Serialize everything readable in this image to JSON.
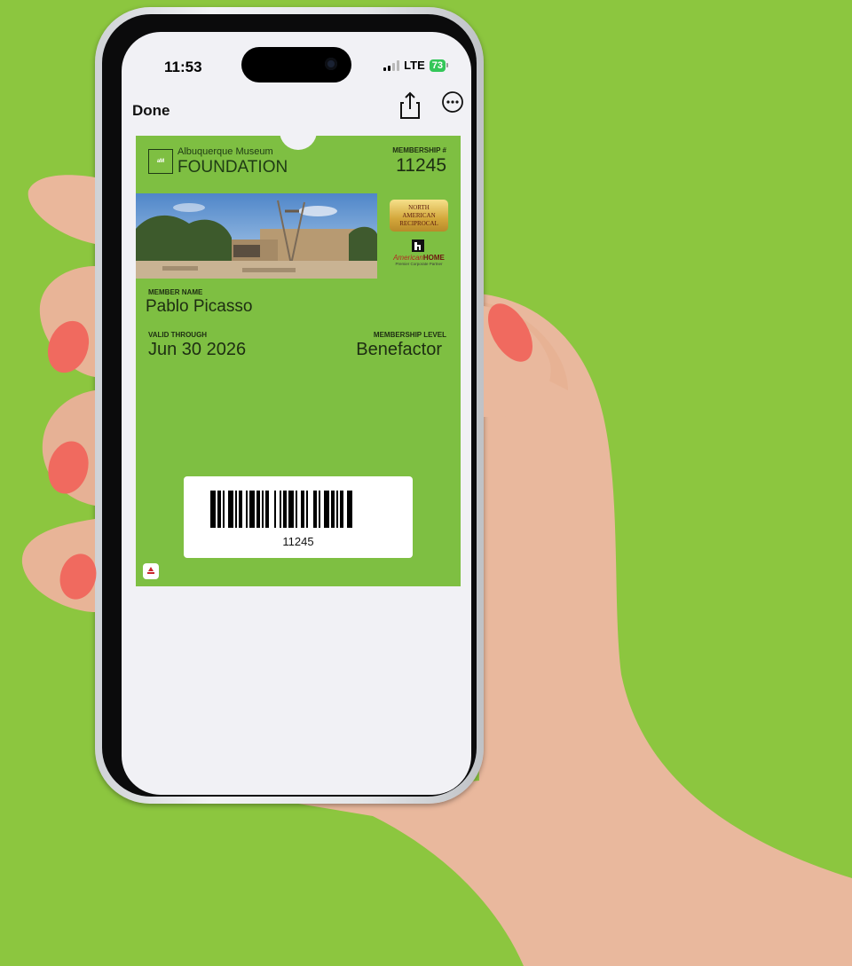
{
  "status_bar": {
    "time": "11:53",
    "network": "LTE",
    "battery_percent": "73"
  },
  "nav": {
    "done_label": "Done",
    "share_icon": "share-icon",
    "more_icon": "ellipsis-circle-icon"
  },
  "pass": {
    "logo": {
      "badge_text": "aM",
      "line1": "Albuquerque Museum",
      "line2": "FOUNDATION"
    },
    "membership_number_label": "MEMBERSHIP #",
    "membership_number": "11245",
    "reciprocal_badge": [
      "NORTH",
      "AMERICAN",
      "RECIPROCAL"
    ],
    "partner": {
      "name_script": "American",
      "name_bold": "HOME",
      "tagline": "Premier Corporate Partner"
    },
    "member_name_label": "MEMBER NAME",
    "member_name": "Pablo Picasso",
    "valid_through_label": "VALID THROUGH",
    "valid_through": "Jun 30 2026",
    "membership_level_label": "MEMBERSHIP LEVEL",
    "membership_level": "Benefactor",
    "barcode_value": "11245",
    "pass_color": "#7ebf42"
  },
  "background_color": "#8cc63f"
}
